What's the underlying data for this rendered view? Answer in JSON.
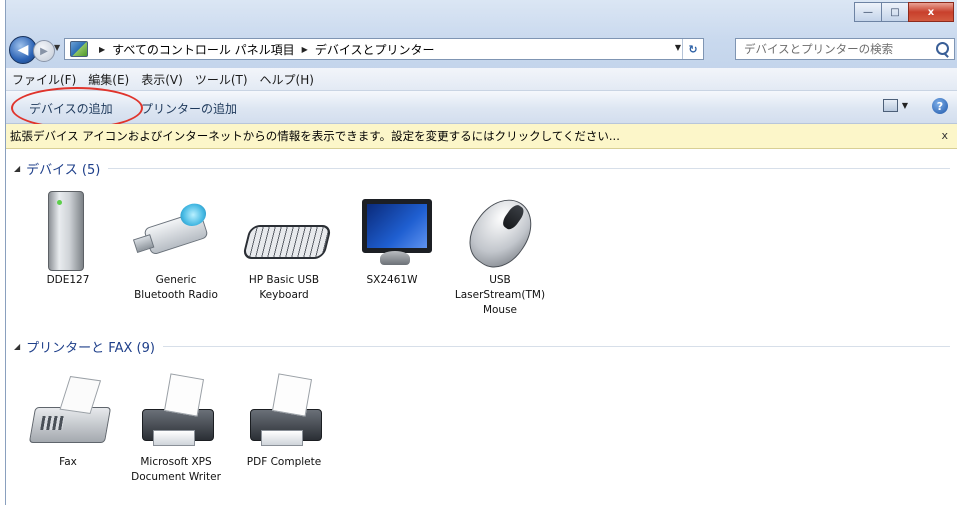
{
  "window": {
    "controls": {
      "minimize": "—",
      "maximize": "□",
      "close": "x"
    }
  },
  "nav": {
    "back_glyph": "◀",
    "forward_glyph": "▶",
    "address": {
      "crumbs": [
        "すべてのコントロール パネル項目",
        "デバイスとプリンター"
      ],
      "separator": "▶"
    },
    "search": {
      "placeholder": "デバイスとプリンターの検索"
    }
  },
  "menubar": {
    "items": [
      "ファイル(F)",
      "編集(E)",
      "表示(V)",
      "ツール(T)",
      "ヘルプ(H)"
    ]
  },
  "commandbar": {
    "add_device": "デバイスの追加",
    "add_printer": "プリンターの追加",
    "help": "?"
  },
  "infobar": {
    "text": "拡張デバイス アイコンおよびインターネットからの情報を表示できます。設定を変更するにはクリックしてください...",
    "close": "x"
  },
  "groups": [
    {
      "header": "デバイス (5)",
      "items": [
        {
          "label": "DDE127",
          "icon": "external-hdd-icon"
        },
        {
          "label": "Generic\nBluetooth Radio",
          "icon": "bluetooth-adapter-icon"
        },
        {
          "label": "HP Basic USB\nKeyboard",
          "icon": "keyboard-icon"
        },
        {
          "label": "SX2461W",
          "icon": "monitor-icon"
        },
        {
          "label": "USB\nLaserStream(TM)\nMouse",
          "icon": "mouse-icon"
        }
      ]
    },
    {
      "header": "プリンターと FAX (9)",
      "items": [
        {
          "label": "Fax",
          "icon": "fax-icon"
        },
        {
          "label": "Microsoft XPS\nDocument Writer",
          "icon": "printer-icon"
        },
        {
          "label": "PDF Complete",
          "icon": "printer-icon"
        }
      ]
    }
  ],
  "colors": {
    "highlight_ring": "#e0342c",
    "infobar_bg": "#fcf6c9",
    "group_header": "#1e3f8a"
  }
}
